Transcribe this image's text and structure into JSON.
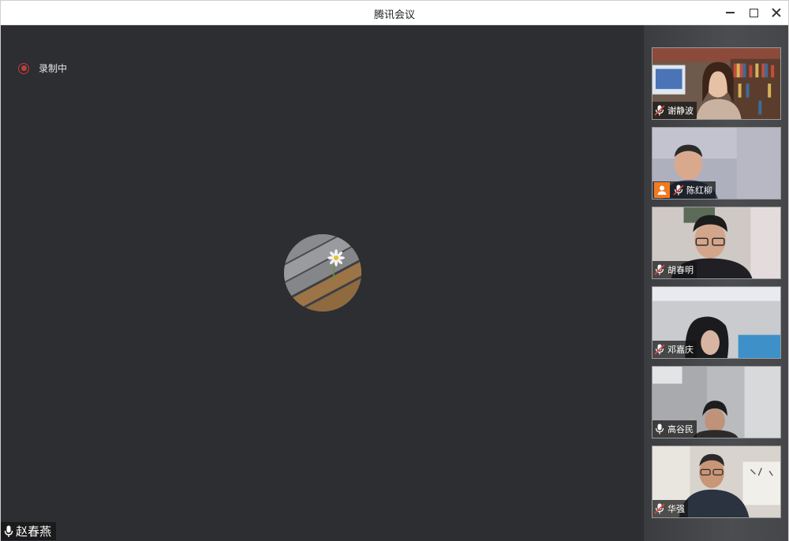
{
  "window": {
    "title": "腾讯会议"
  },
  "stage": {
    "recording_label": "录制中",
    "active_speaker": "赵春燕"
  },
  "participants": [
    {
      "name": "谢静波",
      "mic": "muted",
      "host": false
    },
    {
      "name": "陈红柳",
      "mic": "muted",
      "host": true
    },
    {
      "name": "胡春明",
      "mic": "muted",
      "host": false
    },
    {
      "name": "邓嘉庆",
      "mic": "muted",
      "host": false
    },
    {
      "name": "高谷民",
      "mic": "on",
      "host": false
    },
    {
      "name": "华强",
      "mic": "muted",
      "host": false
    }
  ],
  "colors": {
    "recording": "#c43c3c",
    "host_badge": "#f07a22",
    "stage_bg": "#2c2e31"
  }
}
